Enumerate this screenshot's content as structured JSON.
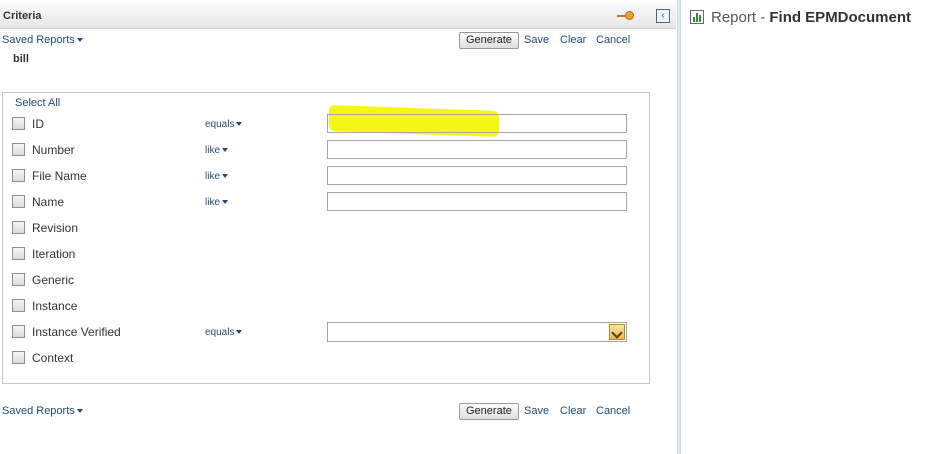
{
  "criteria_panel": {
    "title": "Criteria",
    "saved_reports_label": "Saved Reports",
    "owner_value": "bill",
    "select_all_label": "Select All",
    "actions": {
      "generate": "Generate",
      "save": "Save",
      "clear": "Clear",
      "cancel": "Cancel"
    },
    "rows": [
      {
        "label": "ID",
        "operator": "equals",
        "input": "text",
        "value": ""
      },
      {
        "label": "Number",
        "operator": "like",
        "input": "text",
        "value": ""
      },
      {
        "label": "File Name",
        "operator": "like",
        "input": "text",
        "value": ""
      },
      {
        "label": "Name",
        "operator": "like",
        "input": "text",
        "value": ""
      },
      {
        "label": "Revision",
        "operator": "",
        "input": "",
        "value": ""
      },
      {
        "label": "Iteration",
        "operator": "",
        "input": "",
        "value": ""
      },
      {
        "label": "Generic",
        "operator": "",
        "input": "",
        "value": ""
      },
      {
        "label": "Instance",
        "operator": "",
        "input": "",
        "value": ""
      },
      {
        "label": "Instance Verified",
        "operator": "equals",
        "input": "select",
        "value": ""
      },
      {
        "label": "Context",
        "operator": "",
        "input": "",
        "value": ""
      }
    ]
  },
  "report_panel": {
    "prefix": "Report - ",
    "title": "Find EPMDocument"
  },
  "colors": {
    "link": "#1f4b7a",
    "highlight": "#f5f50a",
    "accent": "#e8b84c"
  }
}
